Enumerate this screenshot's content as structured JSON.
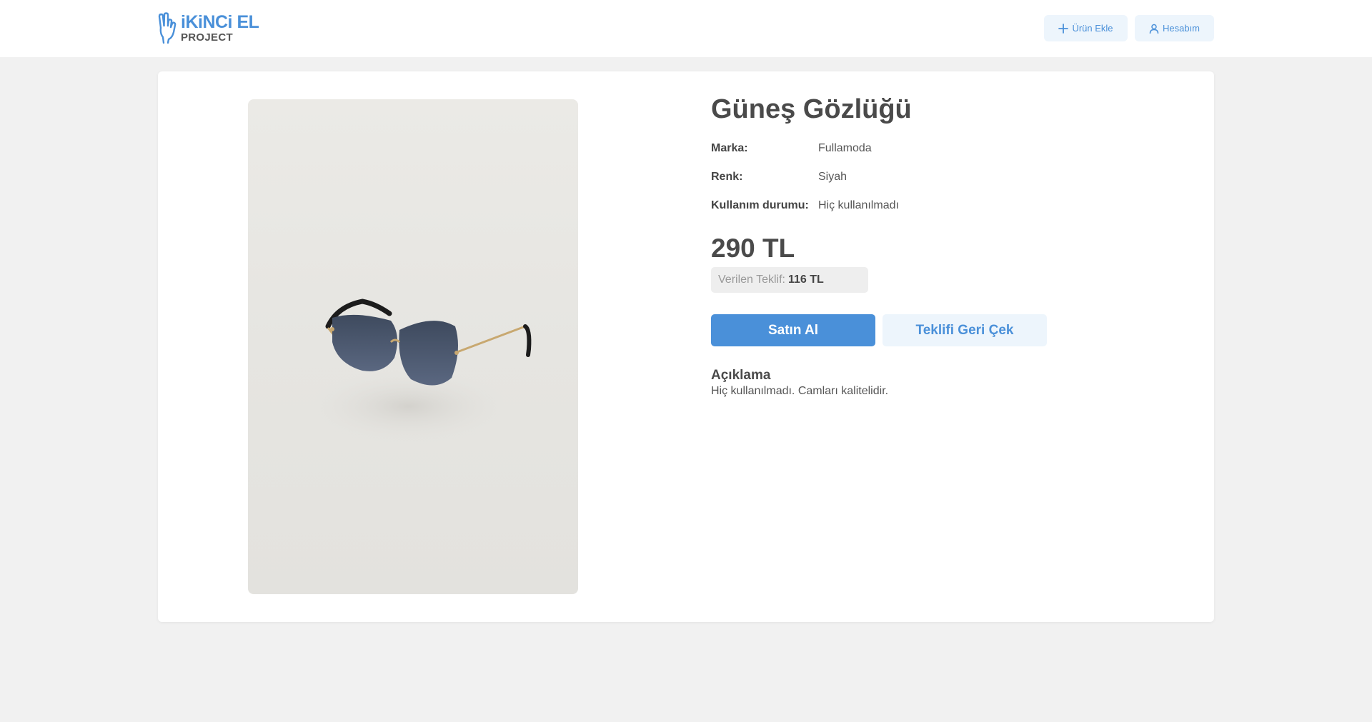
{
  "header": {
    "logo_main": "iKiNCi EL",
    "logo_sub": "PROJECT",
    "add_product_label": "Ürün Ekle",
    "account_label": "Hesabım"
  },
  "product": {
    "title": "Güneş Gözlüğü",
    "attributes": [
      {
        "label": "Marka:",
        "value": "Fullamoda"
      },
      {
        "label": "Renk:",
        "value": "Siyah"
      },
      {
        "label": "Kullanım durumu:",
        "value": "Hiç kullanılmadı"
      }
    ],
    "price": "290 TL",
    "offer_label": "Verilen Teklif:",
    "offer_value": "116 TL",
    "buy_label": "Satın Al",
    "withdraw_label": "Teklifi Geri Çek",
    "description_title": "Açıklama",
    "description": "Hiç kullanılmadı. Camları kalitelidir."
  },
  "colors": {
    "accent": "#4a90d9",
    "accent_light": "#edf5fc",
    "background": "#f1f1f1"
  },
  "icons": {
    "add": "plus-icon",
    "account": "user-icon",
    "logo": "hand-peace-icon"
  }
}
